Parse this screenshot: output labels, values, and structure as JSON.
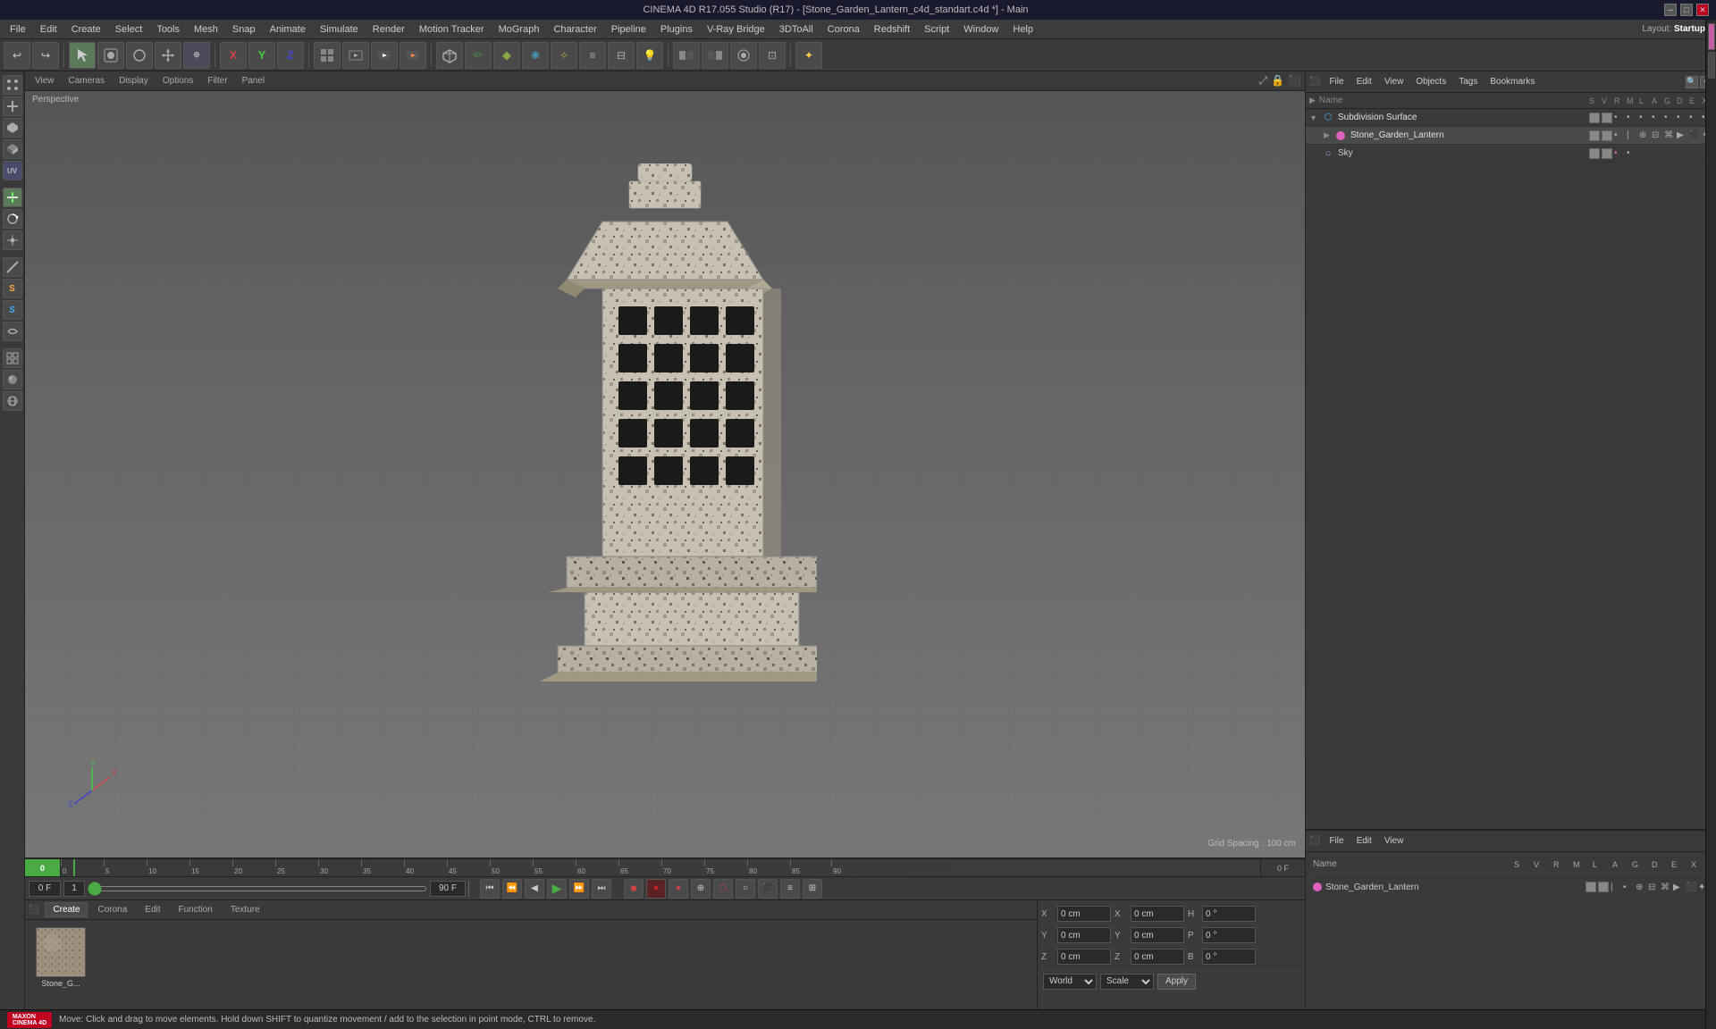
{
  "app": {
    "title": "CINEMA 4D R17.055 Studio (R17) - [Stone_Garden_Lantern_c4d_standart.c4d *] - Main",
    "layout_label": "Layout:",
    "layout_value": "Startup"
  },
  "menu_bar": {
    "items": [
      "File",
      "Edit",
      "Create",
      "Select",
      "Tools",
      "Mesh",
      "Snap",
      "Animate",
      "Simulate",
      "Render",
      "Motion Tracker",
      "MoGraph",
      "Character",
      "Pipeline",
      "Plugins",
      "V-Ray Bridge",
      "3DToAll",
      "Corona",
      "Redshift",
      "Script",
      "Window",
      "Help"
    ]
  },
  "toolbar": {
    "groups": [
      {
        "buttons": [
          "↩",
          "↪"
        ]
      },
      {
        "buttons": [
          "⬡",
          "▣",
          "○",
          "+",
          "⊙"
        ]
      },
      {
        "buttons": [
          "✕",
          "Y",
          "Z"
        ]
      },
      {
        "buttons": [
          "⬜",
          "⬛",
          "⬜",
          "⬜"
        ]
      },
      {
        "buttons": [
          "▶",
          "⬛",
          "⊕"
        ]
      },
      {
        "buttons": [
          "⊙",
          "✏",
          "⋄",
          "❋",
          "✧",
          "≡",
          "⊟",
          "💡"
        ]
      },
      {
        "buttons": [
          "⬜",
          "⬛",
          "⬜",
          "⊡"
        ]
      },
      {
        "buttons": [
          "✦"
        ]
      }
    ]
  },
  "viewport": {
    "tabs": [
      "View",
      "Cameras",
      "Display",
      "Options",
      "Filter",
      "Panel"
    ],
    "perspective_label": "Perspective",
    "grid_spacing": "Grid Spacing : 100 cm"
  },
  "object_manager_top": {
    "menu_items": [
      "File",
      "Edit",
      "View",
      "Objects",
      "Tags",
      "Bookmarks"
    ],
    "header_cols": [
      "S",
      "V",
      "R",
      "M",
      "L",
      "A",
      "G",
      "D",
      "E",
      "X"
    ],
    "objects": [
      {
        "name": "Subdivision Surface",
        "icon": "⬡",
        "indent": 0,
        "has_expand": false,
        "has_children": true,
        "vis_color": "#888"
      },
      {
        "name": "Stone_Garden_Lantern",
        "icon": "⬡",
        "indent": 1,
        "has_expand": true,
        "has_children": true,
        "vis_color": "#e060c0"
      },
      {
        "name": "Sky",
        "icon": "○",
        "indent": 0,
        "has_expand": false,
        "has_children": false,
        "vis_color": "#888"
      }
    ]
  },
  "object_manager_bottom": {
    "menu_items": [
      "File",
      "Edit",
      "View"
    ],
    "header": {
      "name_label": "Name",
      "cols": [
        "S",
        "V",
        "R",
        "M",
        "L",
        "A",
        "G",
        "D",
        "E",
        "X"
      ]
    },
    "materials": [
      {
        "name": "Stone_Garden_Lantern",
        "color": "#e060c0"
      }
    ]
  },
  "timeline": {
    "current_frame": "0 F",
    "end_frame": "90 F",
    "ticks": [
      0,
      5,
      10,
      15,
      20,
      25,
      30,
      35,
      40,
      45,
      50,
      55,
      60,
      65,
      70,
      75,
      80,
      85,
      90
    ],
    "fps_label": "0 F"
  },
  "playback": {
    "current_frame": "0 F",
    "frame_step": "1",
    "slider_pos": "0",
    "end_frame": "90 F",
    "fps_display": "0 F"
  },
  "content_tabs": {
    "tabs": [
      "Create",
      "Corona",
      "Edit",
      "Function",
      "Texture"
    ],
    "active": "Create"
  },
  "coordinates": {
    "x_pos": "0 cm",
    "y_pos": "0 cm",
    "z_pos": "0 cm",
    "x_size": "0 cm",
    "y_size": "0 cm",
    "z_size": "0 cm",
    "p_rot": "0 °",
    "h_rot": "0 °",
    "b_rot": "0 °",
    "world_label": "World",
    "scale_label": "Scale",
    "apply_label": "Apply"
  },
  "status_bar": {
    "message": "Move: Click and drag to move elements. Hold down SHIFT to quantize movement / add to the selection in point mode, CTRL to remove."
  },
  "layout": {
    "label": "Layout:",
    "value": "Startup"
  }
}
